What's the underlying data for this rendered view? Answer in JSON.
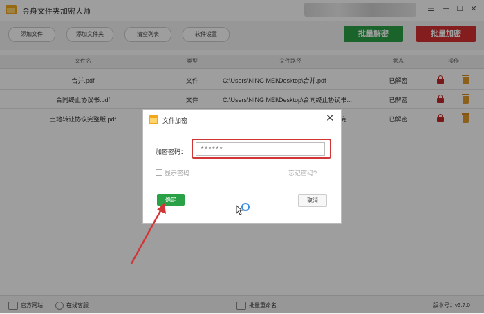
{
  "app": {
    "title": "金舟文件夹加密大师"
  },
  "toolbar": {
    "add_file": "添加文件",
    "add_folder": "添加文件夹",
    "clear_list": "清空列表",
    "settings": "软件设置",
    "batch_decrypt": "批量解密",
    "batch_encrypt": "批量加密",
    "decrypt_color": "#2aa146",
    "encrypt_color": "#d62f2f"
  },
  "table": {
    "columns": [
      "文件名",
      "类型",
      "文件路径",
      "状态",
      "操作"
    ],
    "rows": [
      {
        "name": "合并.pdf",
        "type": "文件",
        "path": "C:\\Users\\NING MEI\\Desktop\\合并.pdf",
        "status": "已解密"
      },
      {
        "name": "合同终止协议书.pdf",
        "type": "文件",
        "path": "C:\\Users\\NING MEI\\Desktop\\合同终止协议书...",
        "status": "已解密"
      },
      {
        "name": "土地转让协议完整版.pdf",
        "type": "文件",
        "path": "C:\\Users\\NING MEI\\Desktop\\土地转让协议完...",
        "status": "已解密"
      }
    ]
  },
  "footer": {
    "website": "官方网站",
    "online_service": "在线客服",
    "batch_rename": "批量重命名",
    "version": "版本号：v3.7.0"
  },
  "dialog": {
    "title": "文件加密",
    "password_label": "加密密码：",
    "password_value": "******",
    "show_password": "显示密码",
    "forgot_password": "忘记密码?",
    "ok": "确定",
    "cancel": "取消"
  },
  "icons": {
    "app_logo": "folder-lock-icon",
    "lock": "lock-icon",
    "trash": "trash-icon",
    "close": "close-icon"
  }
}
